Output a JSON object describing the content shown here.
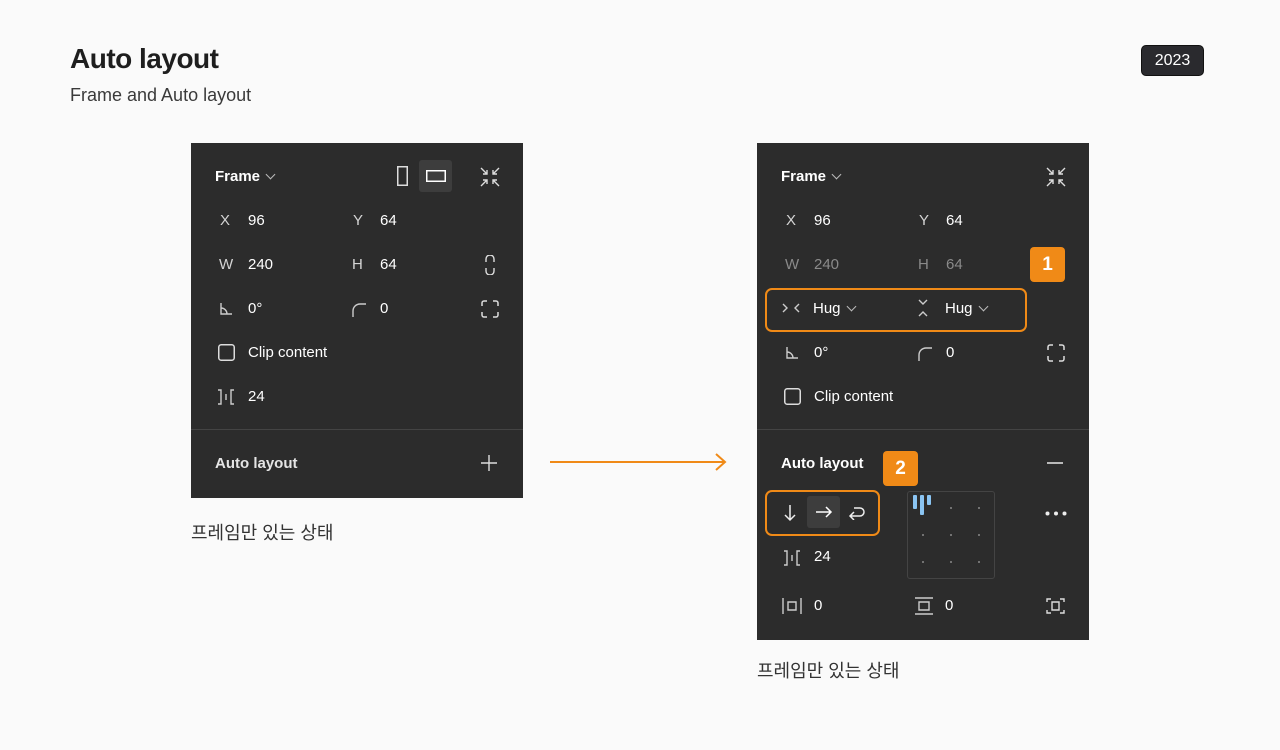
{
  "header": {
    "title": "Auto layout",
    "subtitle": "Frame and Auto layout",
    "year": "2023"
  },
  "left_panel": {
    "frame_label": "Frame",
    "x_label": "X",
    "x_value": "96",
    "y_label": "Y",
    "y_value": "64",
    "w_label": "W",
    "w_value": "240",
    "h_label": "H",
    "h_value": "64",
    "rotation_value": "0°",
    "radius_value": "0",
    "clip_content_label": "Clip content",
    "gap_value": "24",
    "auto_layout_label": "Auto layout",
    "caption": "프레임만 있는 상태"
  },
  "right_panel": {
    "frame_label": "Frame",
    "x_label": "X",
    "x_value": "96",
    "y_label": "Y",
    "y_value": "64",
    "w_label": "W",
    "w_value": "240",
    "h_label": "H",
    "h_value": "64",
    "width_sizing": "Hug",
    "height_sizing": "Hug",
    "rotation_value": "0°",
    "radius_value": "0",
    "clip_content_label": "Clip content",
    "auto_layout_label": "Auto layout",
    "gap_value": "24",
    "horizontal_padding_value": "0",
    "vertical_padding_value": "0",
    "badge_1": "1",
    "badge_2": "2",
    "caption": "프레임만 있는 상태"
  },
  "colors": {
    "panel_bg": "#2c2c2c",
    "accent_orange": "#f08a17",
    "alignment_blue": "#8ac4f2",
    "page_bg": "#fafafa"
  },
  "icons": [
    "chevron-down-icon",
    "portrait-frame-icon",
    "landscape-frame-icon",
    "resize-to-fit-icon",
    "constrain-proportions-icon",
    "rotation-icon",
    "corner-radius-icon",
    "independent-corners-icon",
    "checkbox-icon",
    "spacing-icon",
    "plus-icon",
    "minus-icon",
    "hug-width-icon",
    "hug-height-icon",
    "arrow-down-icon",
    "arrow-right-icon",
    "wrap-icon",
    "alignment-grid",
    "more-icon",
    "horizontal-padding-icon",
    "vertical-padding-icon",
    "independent-padding-icon",
    "arrow-icon"
  ]
}
